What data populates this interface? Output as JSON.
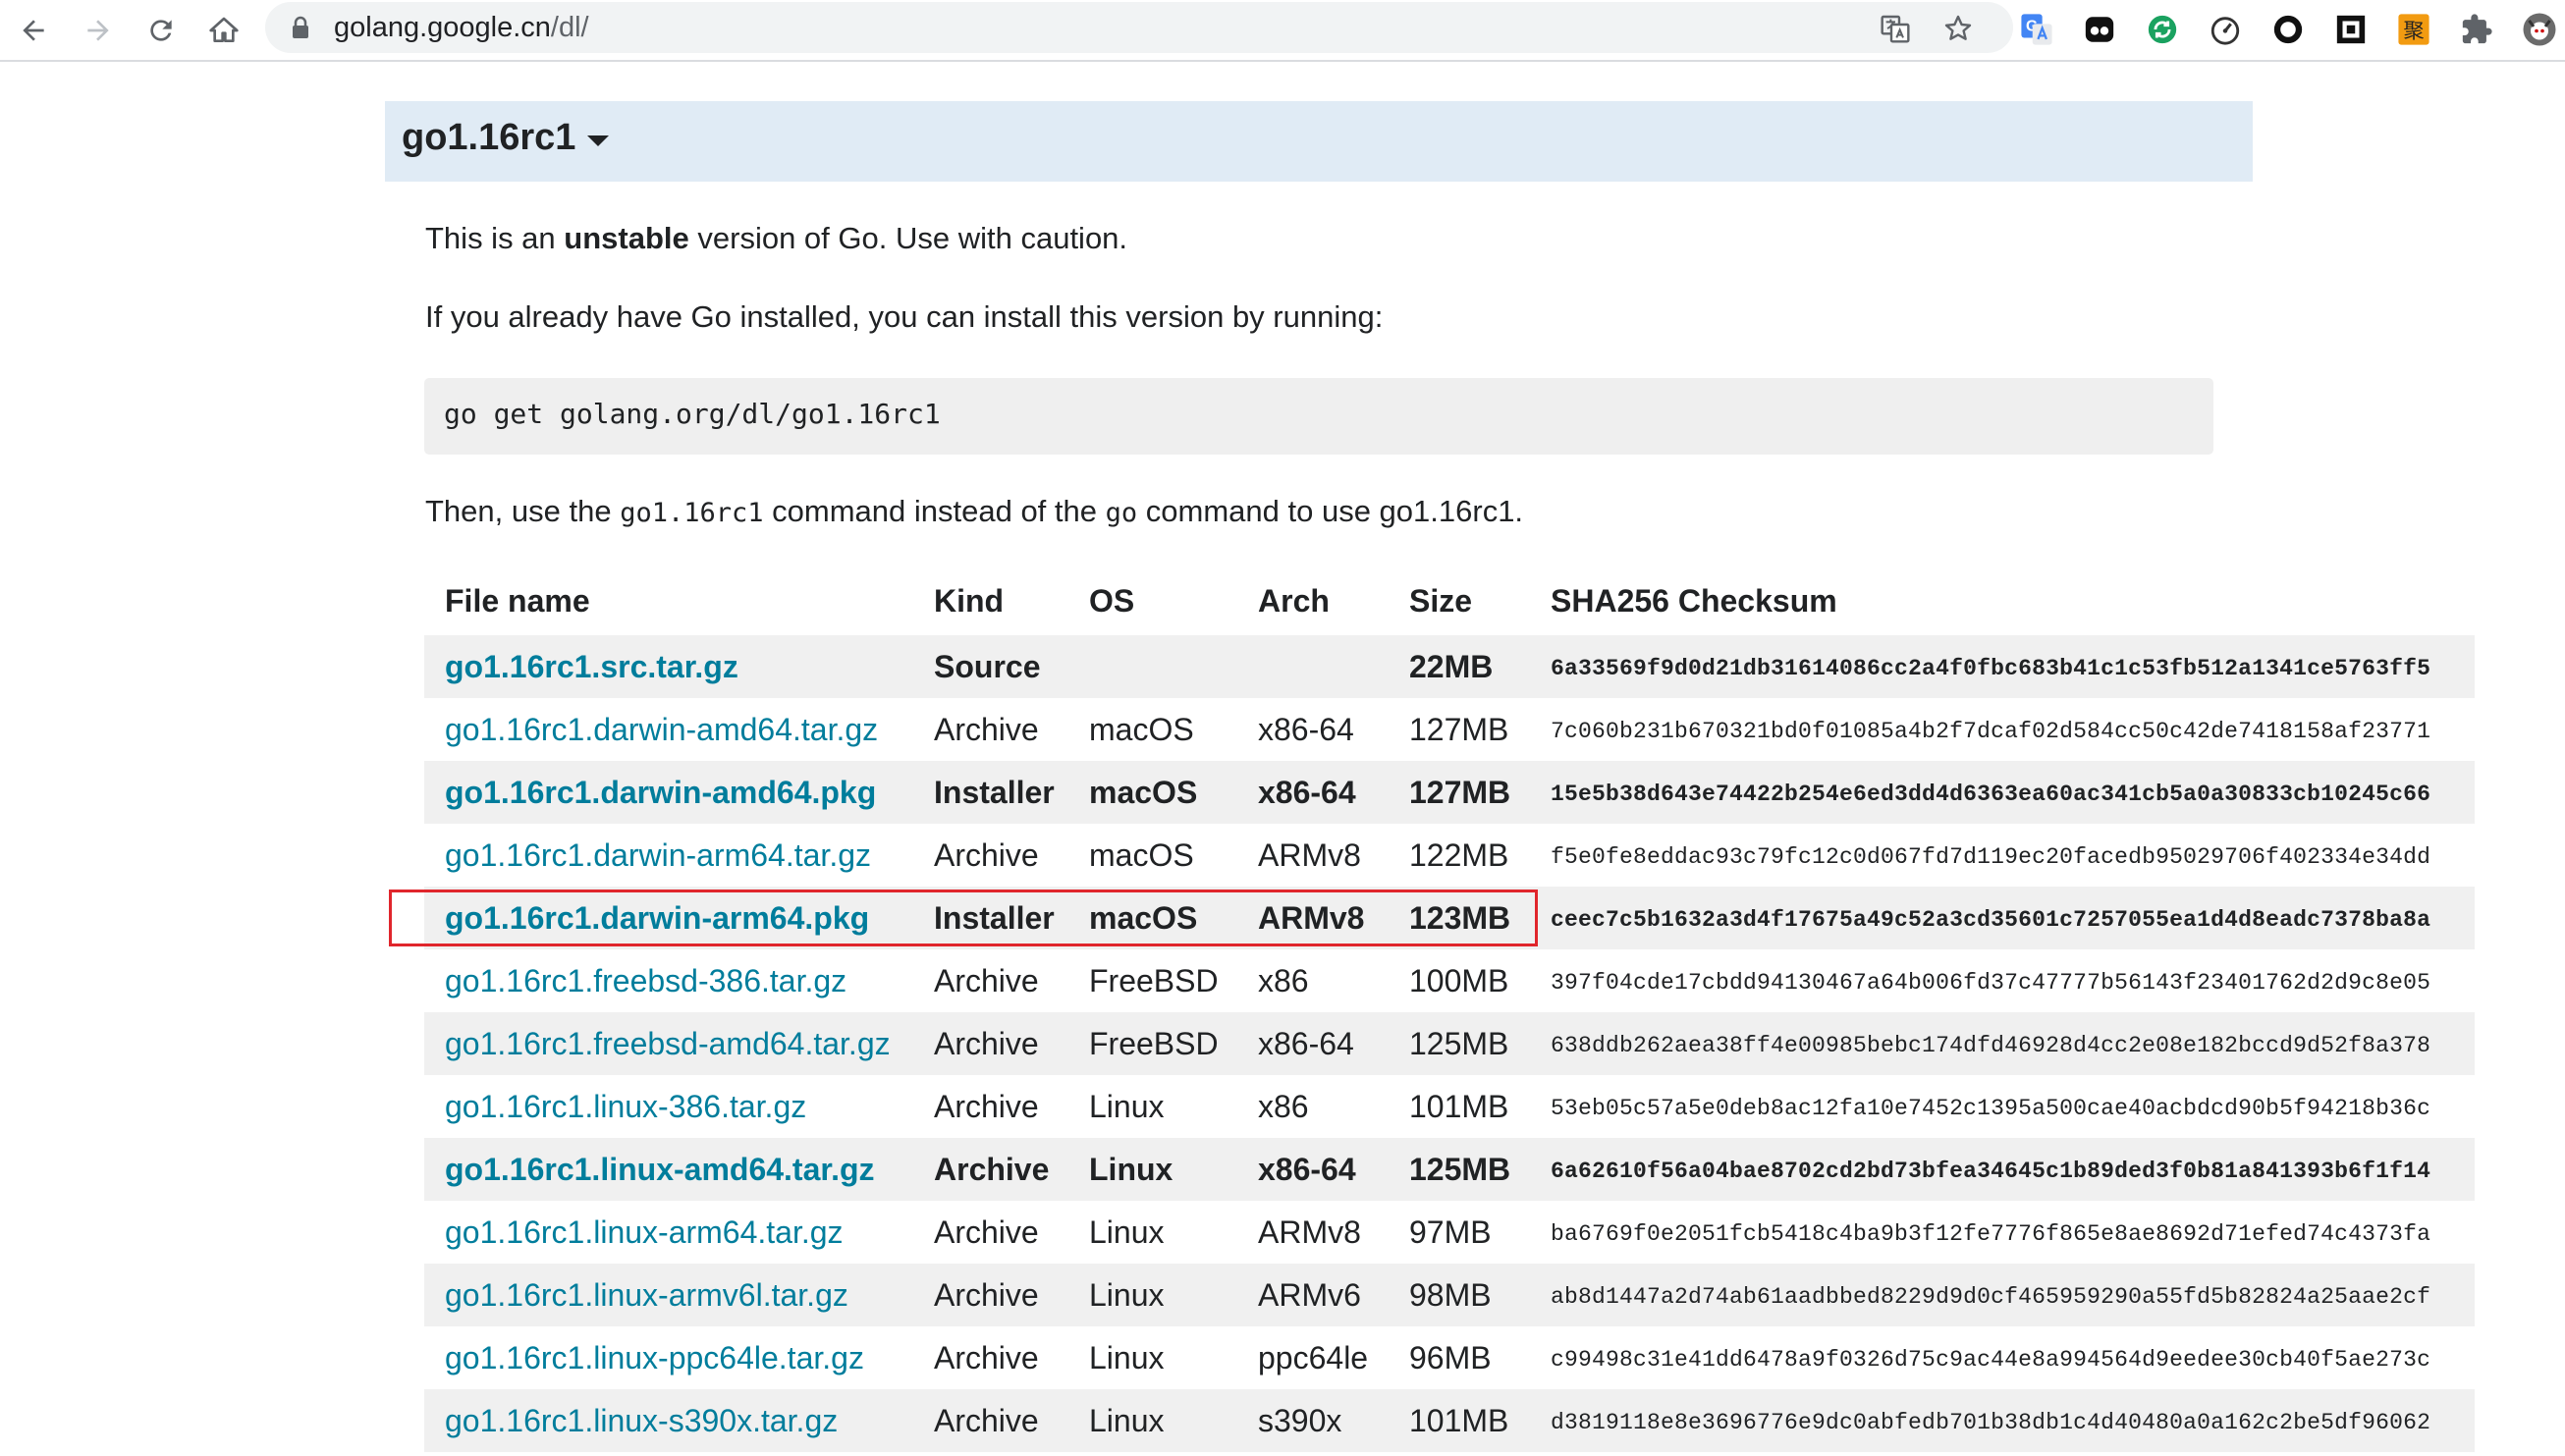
{
  "browser": {
    "url_host": "golang.google.cn",
    "url_path": "/dl/"
  },
  "release": {
    "title": "go1.16rc1",
    "warning_prefix": "This is an",
    "warning_bold": "unstable",
    "warning_suffix": "version of Go. Use with caution.",
    "install_text": "If you already have Go installed, you can install this version by running:",
    "command": "go get golang.org/dl/go1.16rc1",
    "then_prefix": "Then, use the",
    "then_cmd1": "go1.16rc1",
    "then_mid": "command instead of the",
    "then_cmd2": "go",
    "then_suffix": "command to use go1.16rc1."
  },
  "table": {
    "headers": {
      "file": "File name",
      "kind": "Kind",
      "os": "OS",
      "arch": "Arch",
      "size": "Size",
      "sha": "SHA256 Checksum"
    },
    "rows": [
      {
        "file": "go1.16rc1.src.tar.gz",
        "kind": "Source",
        "os": "",
        "arch": "",
        "size": "22MB",
        "sha": "6a33569f9d0d21db31614086cc2a4f0fbc683b41c1c53fb512a1341ce5763ff5",
        "highlight": true
      },
      {
        "file": "go1.16rc1.darwin-amd64.tar.gz",
        "kind": "Archive",
        "os": "macOS",
        "arch": "x86-64",
        "size": "127MB",
        "sha": "7c060b231b670321bd0f01085a4b2f7dcaf02d584cc50c42de7418158af23771",
        "highlight": false
      },
      {
        "file": "go1.16rc1.darwin-amd64.pkg",
        "kind": "Installer",
        "os": "macOS",
        "arch": "x86-64",
        "size": "127MB",
        "sha": "15e5b38d643e74422b254e6ed3dd4d6363ea60ac341cb5a0a30833cb10245c66",
        "highlight": true
      },
      {
        "file": "go1.16rc1.darwin-arm64.tar.gz",
        "kind": "Archive",
        "os": "macOS",
        "arch": "ARMv8",
        "size": "122MB",
        "sha": "f5e0fe8eddac93c79fc12c0d067fd7d119ec20facedb95029706f402334e34dd",
        "highlight": false
      },
      {
        "file": "go1.16rc1.darwin-arm64.pkg",
        "kind": "Installer",
        "os": "macOS",
        "arch": "ARMv8",
        "size": "123MB",
        "sha": "ceec7c5b1632a3d4f17675a49c52a3cd35601c7257055ea1d4d8eadc7378ba8a",
        "highlight": true
      },
      {
        "file": "go1.16rc1.freebsd-386.tar.gz",
        "kind": "Archive",
        "os": "FreeBSD",
        "arch": "x86",
        "size": "100MB",
        "sha": "397f04cde17cbdd94130467a64b006fd37c47777b56143f23401762d2d9c8e05",
        "highlight": false
      },
      {
        "file": "go1.16rc1.freebsd-amd64.tar.gz",
        "kind": "Archive",
        "os": "FreeBSD",
        "arch": "x86-64",
        "size": "125MB",
        "sha": "638ddb262aea38ff4e00985bebc174dfd46928d4cc2e08e182bccd9d52f8a378",
        "highlight": false
      },
      {
        "file": "go1.16rc1.linux-386.tar.gz",
        "kind": "Archive",
        "os": "Linux",
        "arch": "x86",
        "size": "101MB",
        "sha": "53eb05c57a5e0deb8ac12fa10e7452c1395a500cae40acbdcd90b5f94218b36c",
        "highlight": false
      },
      {
        "file": "go1.16rc1.linux-amd64.tar.gz",
        "kind": "Archive",
        "os": "Linux",
        "arch": "x86-64",
        "size": "125MB",
        "sha": "6a62610f56a04bae8702cd2bd73bfea34645c1b89ded3f0b81a841393b6f1f14",
        "highlight": true
      },
      {
        "file": "go1.16rc1.linux-arm64.tar.gz",
        "kind": "Archive",
        "os": "Linux",
        "arch": "ARMv8",
        "size": "97MB",
        "sha": "ba6769f0e2051fcb5418c4ba9b3f12fe7776f865e8ae8692d71efed74c4373fa",
        "highlight": false
      },
      {
        "file": "go1.16rc1.linux-armv6l.tar.gz",
        "kind": "Archive",
        "os": "Linux",
        "arch": "ARMv6",
        "size": "98MB",
        "sha": "ab8d1447a2d74ab61aadbbed8229d9d0cf465959290a55fd5b82824a25aae2cf",
        "highlight": false
      },
      {
        "file": "go1.16rc1.linux-ppc64le.tar.gz",
        "kind": "Archive",
        "os": "Linux",
        "arch": "ppc64le",
        "size": "96MB",
        "sha": "c99498c31e41dd6478a9f0326d75c9ac44e8a994564d9eedee30cb40f5ae273c",
        "highlight": false
      },
      {
        "file": "go1.16rc1.linux-s390x.tar.gz",
        "kind": "Archive",
        "os": "Linux",
        "arch": "s390x",
        "size": "101MB",
        "sha": "d3819118e8e3696776e9dc0abfedb701b38db1c4d40480a0a162c2be5df96062",
        "highlight": false
      }
    ]
  },
  "colors": {
    "link": "#007d9c",
    "header_bg": "#e0ebf5",
    "row_alt": "#f0f0f0",
    "annotation": "#e0262c"
  },
  "extensions": [
    "translate-icon",
    "star-icon",
    "google-translate-icon",
    "extension-icon",
    "refresh-sync-icon",
    "speedometer-icon",
    "circle-icon",
    "qr-icon",
    "ju-icon",
    "puzzle-icon",
    "avatar-icon"
  ]
}
